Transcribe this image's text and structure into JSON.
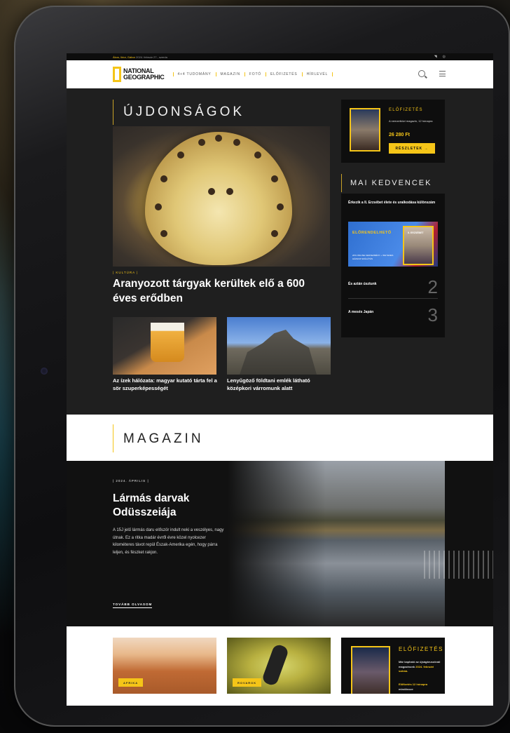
{
  "topbar": {
    "links": "Ákos, Iktor, Gábor",
    "date": "2024. február 27., szerda",
    "icons": [
      "rss-icon",
      "instagram-icon"
    ]
  },
  "header": {
    "logo_line1": "NATIONAL",
    "logo_line2": "GEOGRAPHIC",
    "nav": [
      "4+4 TUDOMÁNY",
      "MAGAZIN",
      "FOTÓ",
      "ELŐFIZETÉS",
      "HÍRLEVÉL"
    ]
  },
  "news": {
    "section_title": "ÚJDONSÁGOK",
    "hero": {
      "category": "| KULTÚRA |",
      "title": "Aranyozott tárgyak kerültek elő a 600 éves erődben"
    },
    "articles": [
      {
        "title": "Az ízek hálózata: magyar kutató tárta fel a sör szuperképességét"
      },
      {
        "title": "Lenyűgöző földtani emlék látható középkori várromunk alatt"
      }
    ]
  },
  "subscription": {
    "label": "ELŐFIZETÉS",
    "desc": "A nemzetközi magazin, 12 hónapra",
    "price": "26 280 Ft",
    "button": "RÉSZLETEK →"
  },
  "favorites": {
    "title": "MAI KEDVENCEK",
    "first": "Érkezik a II. Erzsébet élete és uralkodása különszám",
    "promo_label": "ELŐRENDELHETŐ",
    "promo_desc": "20% ONLINE KEDVEZMÉNY + INGYENES HÁZHOZ SZÁLLÍTÁS",
    "promo_cover": "II. ERZSÉBET",
    "items": [
      {
        "title": "És aztán úsztunk",
        "num": "2"
      },
      {
        "title": "A mesés Japán",
        "num": "3"
      }
    ]
  },
  "magazin": {
    "section_title": "MAGAZIN",
    "date": "| 2024. ÁPRILIS |",
    "title": "Lármás darvak Odüsszeiája",
    "desc": "A 15J jelű lármás daru először indult neki a veszélyes, nagy útnak. Ez a ritka madár évről évre közel nyolcezer kilométeres távot repül Észak-Amerika egén, hogy párra leljen, és fészket rakjon.",
    "more": "TOVÁBB OLVASOM"
  },
  "bottom": {
    "tags": [
      "AFRIKA",
      "ROVAROK"
    ],
    "sub_label": "ELŐFIZETÉS",
    "sub_desc_a": "Már kapható az újságárusoknál magazinunk",
    "sub_desc_b": "2024. februári száma.",
    "sub_desc_c": "Előfizetés 12 hónapra",
    "sub_desc_d": "mindössze"
  },
  "colors": {
    "accent": "#f5c518",
    "dark": "#1f1f1f",
    "black": "#0e0e0e"
  }
}
